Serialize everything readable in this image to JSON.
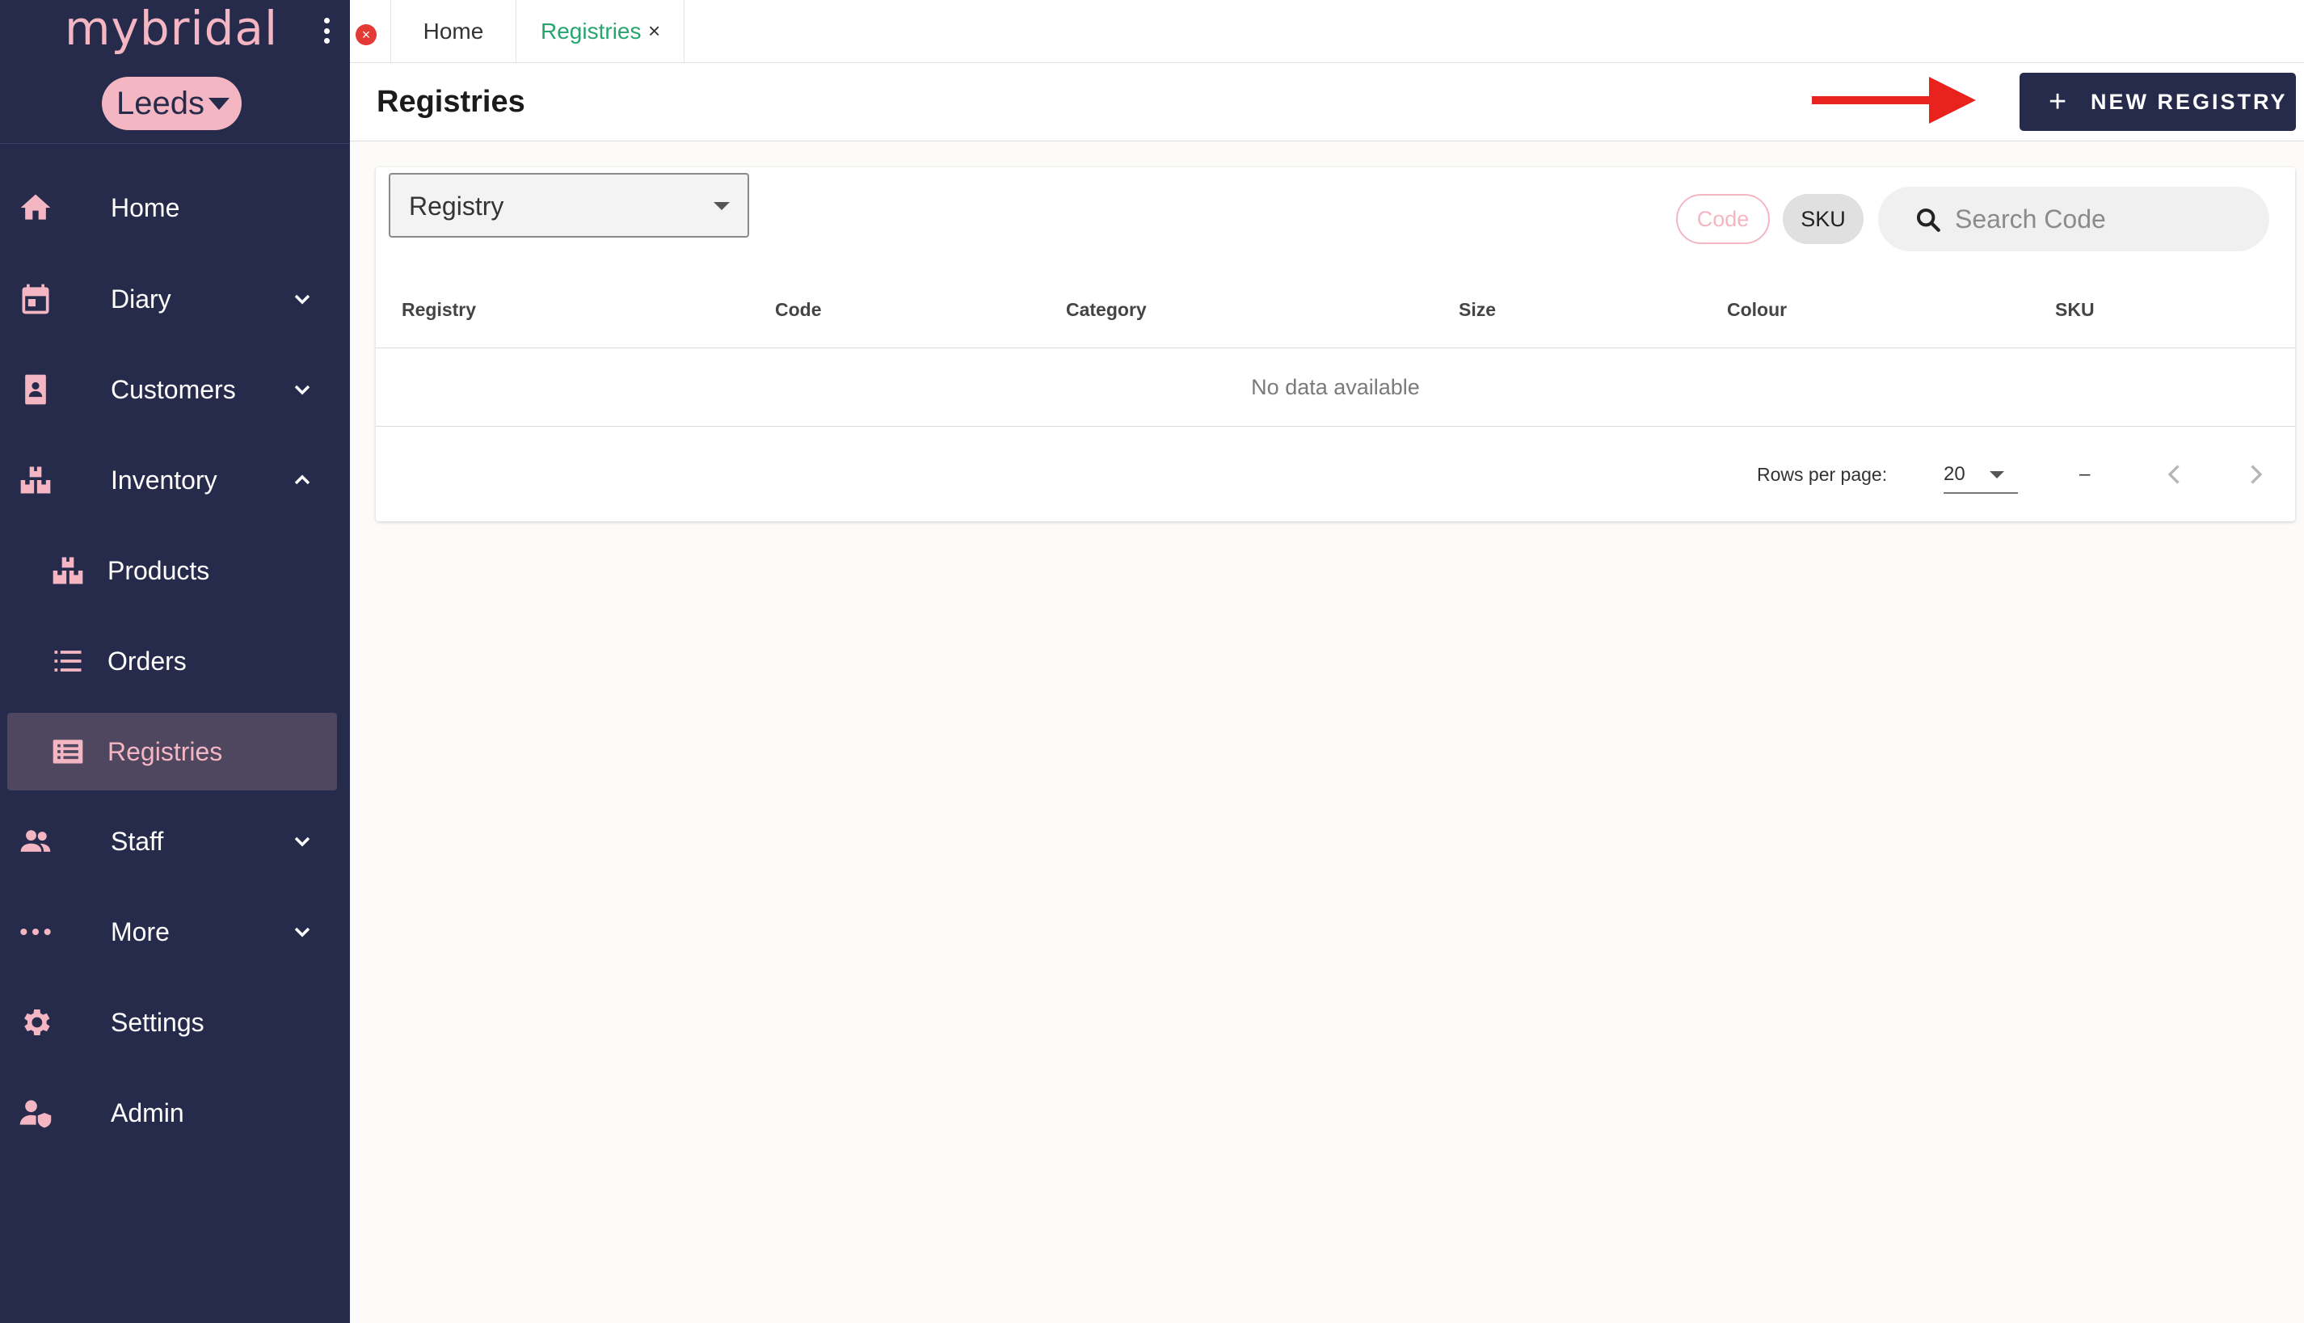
{
  "sidebar": {
    "logo": "mybridal",
    "branch": "Leeds",
    "items": [
      {
        "label": "Home",
        "icon": "home-icon"
      },
      {
        "label": "Diary",
        "icon": "calendar-icon"
      },
      {
        "label": "Customers",
        "icon": "contacts-icon"
      },
      {
        "label": "Inventory",
        "icon": "boxes-icon"
      },
      {
        "label": "Products",
        "icon": "boxes-icon"
      },
      {
        "label": "Orders",
        "icon": "list-icon"
      },
      {
        "label": "Registries",
        "icon": "registry-list-icon"
      },
      {
        "label": "Staff",
        "icon": "people-icon"
      },
      {
        "label": "More",
        "icon": "dots-icon"
      },
      {
        "label": "Settings",
        "icon": "gear-icon"
      },
      {
        "label": "Admin",
        "icon": "user-shield-icon"
      }
    ],
    "active_item": "Registries"
  },
  "tabs": [
    {
      "label": "Home"
    },
    {
      "label": "Registries",
      "close": "×"
    }
  ],
  "header": {
    "title": "Registries",
    "new_button": {
      "plus": "+",
      "label": "NEW REGISTRY"
    }
  },
  "filters": {
    "select_value": "Registry",
    "chips": [
      {
        "label": "Code"
      },
      {
        "label": "SKU"
      }
    ],
    "search_placeholder": "Search Code"
  },
  "table": {
    "columns": [
      "Registry",
      "Code",
      "Category",
      "Size",
      "Colour",
      "SKU"
    ],
    "empty_message": "No data available"
  },
  "pagination": {
    "rows_per_page_label": "Rows per page:",
    "rows_per_page": "20",
    "range": "–"
  },
  "colors": {
    "sidebar_bg": "#262b4b",
    "accent_pink": "#f4b6c2",
    "active_tab_green": "#26a66e",
    "annotation_arrow": "#e8231d"
  }
}
